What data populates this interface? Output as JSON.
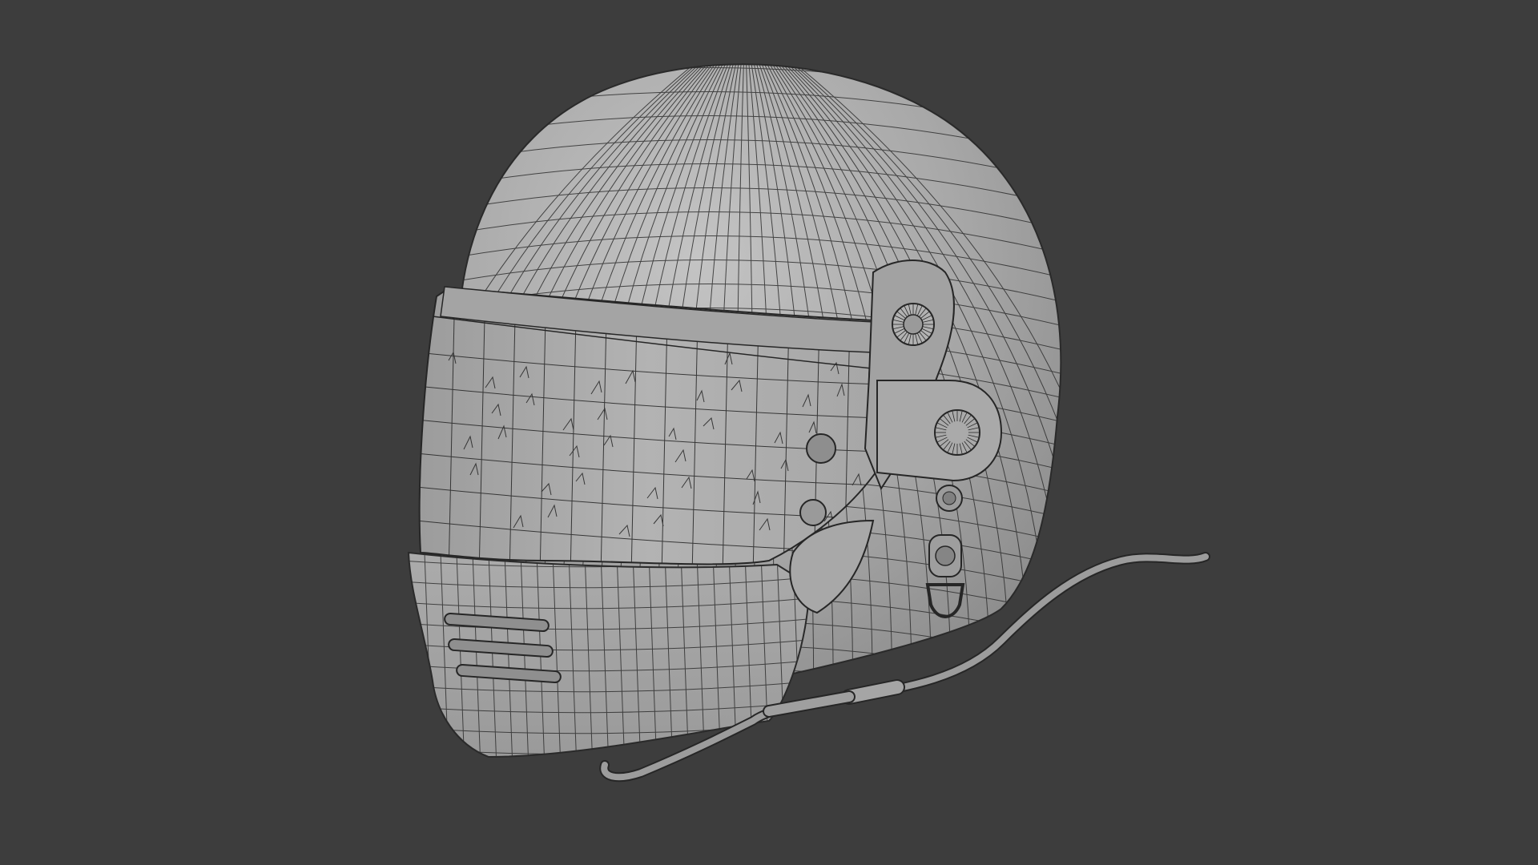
{
  "viewport": {
    "background_color": "#3d3d3d",
    "display_mode": "wireframe-on-shaded",
    "subject": "racing-helmet-model"
  },
  "model": {
    "shell_color": "#a7a7a7",
    "wire_color": "#2b2b2b",
    "visor_color": "#b0b0b0"
  }
}
